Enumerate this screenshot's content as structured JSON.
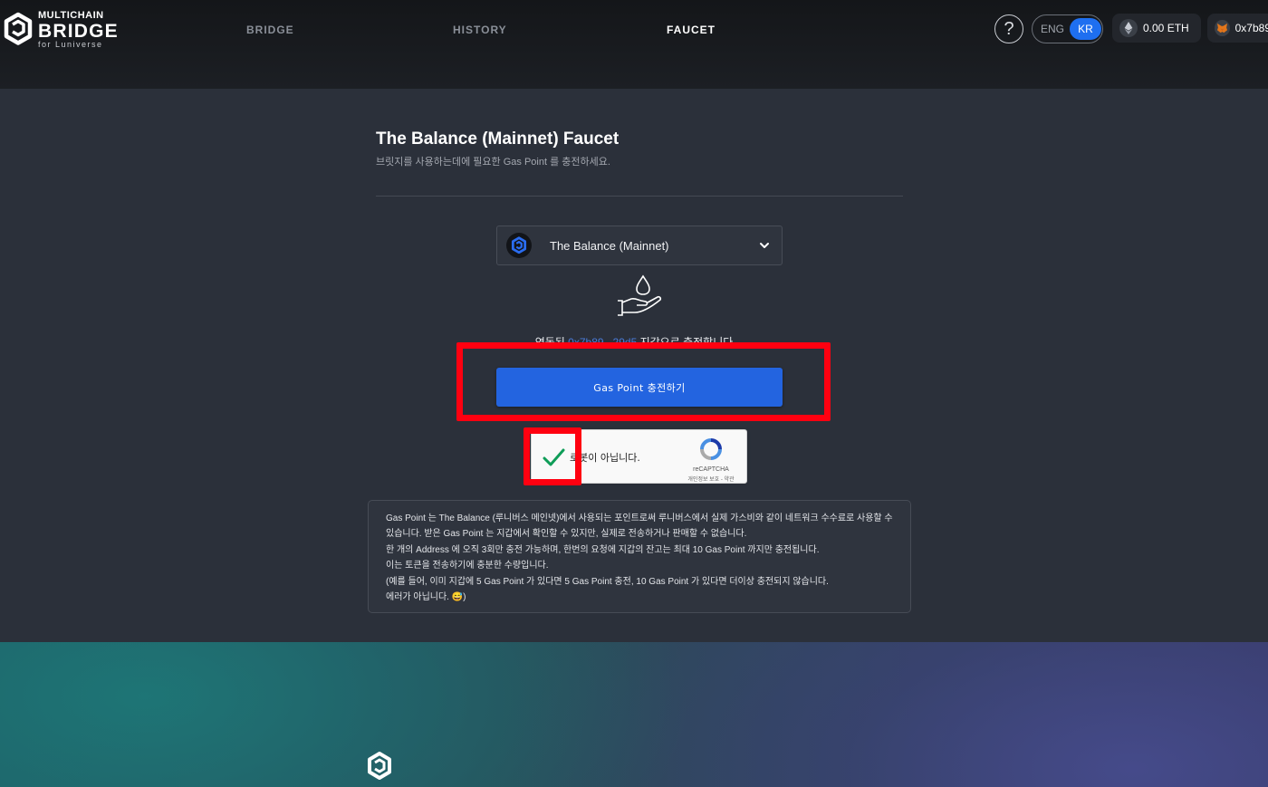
{
  "header": {
    "logo": {
      "top": "MULTICHAIN",
      "main": "BRIDGE",
      "sub": "for Luniverse"
    },
    "nav": [
      {
        "label": "BRIDGE",
        "active": false
      },
      {
        "label": "HISTORY",
        "active": false
      },
      {
        "label": "FAUCET",
        "active": true
      }
    ],
    "help_label": "?",
    "lang": {
      "eng": "ENG",
      "kr": "KR",
      "selected": "KR"
    },
    "balance": "0.00 ETH",
    "address": "0x7b89..."
  },
  "faucet": {
    "title": "The Balance (Mainnet) Faucet",
    "subtitle": "브릿지를 사용하는데에 필요한 Gas Point 를 충전하세요.",
    "chain_select": {
      "value": "The Balance (Mainnet)"
    },
    "connected": {
      "prefix": "연동된",
      "address": "0x7b89...29d5",
      "suffix": "지갑으로 충전합니다"
    },
    "charge_button": "Gas Point 충전하기",
    "recaptcha": {
      "label": "로봇이 아닙니다.",
      "brand": "reCAPTCHA",
      "links": "개인정보 보호 - 약관",
      "checked": true
    },
    "info": [
      "Gas Point 는 The Balance (루니버스 메인넷)에서 사용되는 포인트로써 루니버스에서 실제 가스비와 같이 네트워크 수수료로 사용할 수",
      "있습니다. 받은 Gas Point 는 지갑에서 확인할 수 있지만, 실제로 전송하거나 판매할 수 없습니다.",
      "한 개의 Address 에 오직 3회만 충전 가능하며, 한번의 요청에 지갑의 잔고는 최대 10 Gas Point 까지만 충전됩니다.",
      "이는 토큰을 전송하기에 충분한 수량입니다.",
      "(예를 들어, 이미 지갑에 5 Gas Point 가 있다면 5 Gas Point 충전, 10 Gas Point 가 있다면 더이상 충전되지 않습니다.",
      "에러가 아닙니다. 😅)"
    ]
  },
  "colors": {
    "accent": "#2364e0",
    "highlight": "#ff0010",
    "background": "#2b303a",
    "header": "#1a1c20"
  },
  "icons": [
    "multichain-bridge-logo",
    "help-icon",
    "eth-icon",
    "metamask-fox-icon",
    "chain-logo-icon",
    "chevron-down-icon",
    "faucet-hand-drop-icon",
    "recaptcha-checkmark-icon",
    "recaptcha-logo-icon",
    "footer-logo-icon"
  ]
}
